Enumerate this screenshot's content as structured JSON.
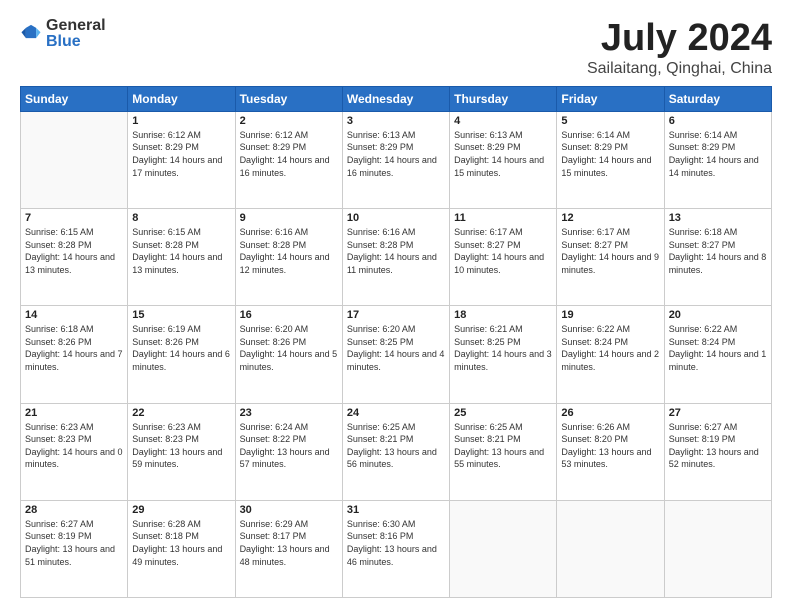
{
  "header": {
    "logo_general": "General",
    "logo_blue": "Blue",
    "month_title": "July 2024",
    "location": "Sailaitang, Qinghai, China"
  },
  "weekdays": [
    "Sunday",
    "Monday",
    "Tuesday",
    "Wednesday",
    "Thursday",
    "Friday",
    "Saturday"
  ],
  "weeks": [
    [
      {
        "day": "",
        "sunrise": "",
        "sunset": "",
        "daylight": ""
      },
      {
        "day": "1",
        "sunrise": "Sunrise: 6:12 AM",
        "sunset": "Sunset: 8:29 PM",
        "daylight": "Daylight: 14 hours and 17 minutes."
      },
      {
        "day": "2",
        "sunrise": "Sunrise: 6:12 AM",
        "sunset": "Sunset: 8:29 PM",
        "daylight": "Daylight: 14 hours and 16 minutes."
      },
      {
        "day": "3",
        "sunrise": "Sunrise: 6:13 AM",
        "sunset": "Sunset: 8:29 PM",
        "daylight": "Daylight: 14 hours and 16 minutes."
      },
      {
        "day": "4",
        "sunrise": "Sunrise: 6:13 AM",
        "sunset": "Sunset: 8:29 PM",
        "daylight": "Daylight: 14 hours and 15 minutes."
      },
      {
        "day": "5",
        "sunrise": "Sunrise: 6:14 AM",
        "sunset": "Sunset: 8:29 PM",
        "daylight": "Daylight: 14 hours and 15 minutes."
      },
      {
        "day": "6",
        "sunrise": "Sunrise: 6:14 AM",
        "sunset": "Sunset: 8:29 PM",
        "daylight": "Daylight: 14 hours and 14 minutes."
      }
    ],
    [
      {
        "day": "7",
        "sunrise": "Sunrise: 6:15 AM",
        "sunset": "Sunset: 8:28 PM",
        "daylight": "Daylight: 14 hours and 13 minutes."
      },
      {
        "day": "8",
        "sunrise": "Sunrise: 6:15 AM",
        "sunset": "Sunset: 8:28 PM",
        "daylight": "Daylight: 14 hours and 13 minutes."
      },
      {
        "day": "9",
        "sunrise": "Sunrise: 6:16 AM",
        "sunset": "Sunset: 8:28 PM",
        "daylight": "Daylight: 14 hours and 12 minutes."
      },
      {
        "day": "10",
        "sunrise": "Sunrise: 6:16 AM",
        "sunset": "Sunset: 8:28 PM",
        "daylight": "Daylight: 14 hours and 11 minutes."
      },
      {
        "day": "11",
        "sunrise": "Sunrise: 6:17 AM",
        "sunset": "Sunset: 8:27 PM",
        "daylight": "Daylight: 14 hours and 10 minutes."
      },
      {
        "day": "12",
        "sunrise": "Sunrise: 6:17 AM",
        "sunset": "Sunset: 8:27 PM",
        "daylight": "Daylight: 14 hours and 9 minutes."
      },
      {
        "day": "13",
        "sunrise": "Sunrise: 6:18 AM",
        "sunset": "Sunset: 8:27 PM",
        "daylight": "Daylight: 14 hours and 8 minutes."
      }
    ],
    [
      {
        "day": "14",
        "sunrise": "Sunrise: 6:18 AM",
        "sunset": "Sunset: 8:26 PM",
        "daylight": "Daylight: 14 hours and 7 minutes."
      },
      {
        "day": "15",
        "sunrise": "Sunrise: 6:19 AM",
        "sunset": "Sunset: 8:26 PM",
        "daylight": "Daylight: 14 hours and 6 minutes."
      },
      {
        "day": "16",
        "sunrise": "Sunrise: 6:20 AM",
        "sunset": "Sunset: 8:26 PM",
        "daylight": "Daylight: 14 hours and 5 minutes."
      },
      {
        "day": "17",
        "sunrise": "Sunrise: 6:20 AM",
        "sunset": "Sunset: 8:25 PM",
        "daylight": "Daylight: 14 hours and 4 minutes."
      },
      {
        "day": "18",
        "sunrise": "Sunrise: 6:21 AM",
        "sunset": "Sunset: 8:25 PM",
        "daylight": "Daylight: 14 hours and 3 minutes."
      },
      {
        "day": "19",
        "sunrise": "Sunrise: 6:22 AM",
        "sunset": "Sunset: 8:24 PM",
        "daylight": "Daylight: 14 hours and 2 minutes."
      },
      {
        "day": "20",
        "sunrise": "Sunrise: 6:22 AM",
        "sunset": "Sunset: 8:24 PM",
        "daylight": "Daylight: 14 hours and 1 minute."
      }
    ],
    [
      {
        "day": "21",
        "sunrise": "Sunrise: 6:23 AM",
        "sunset": "Sunset: 8:23 PM",
        "daylight": "Daylight: 14 hours and 0 minutes."
      },
      {
        "day": "22",
        "sunrise": "Sunrise: 6:23 AM",
        "sunset": "Sunset: 8:23 PM",
        "daylight": "Daylight: 13 hours and 59 minutes."
      },
      {
        "day": "23",
        "sunrise": "Sunrise: 6:24 AM",
        "sunset": "Sunset: 8:22 PM",
        "daylight": "Daylight: 13 hours and 57 minutes."
      },
      {
        "day": "24",
        "sunrise": "Sunrise: 6:25 AM",
        "sunset": "Sunset: 8:21 PM",
        "daylight": "Daylight: 13 hours and 56 minutes."
      },
      {
        "day": "25",
        "sunrise": "Sunrise: 6:25 AM",
        "sunset": "Sunset: 8:21 PM",
        "daylight": "Daylight: 13 hours and 55 minutes."
      },
      {
        "day": "26",
        "sunrise": "Sunrise: 6:26 AM",
        "sunset": "Sunset: 8:20 PM",
        "daylight": "Daylight: 13 hours and 53 minutes."
      },
      {
        "day": "27",
        "sunrise": "Sunrise: 6:27 AM",
        "sunset": "Sunset: 8:19 PM",
        "daylight": "Daylight: 13 hours and 52 minutes."
      }
    ],
    [
      {
        "day": "28",
        "sunrise": "Sunrise: 6:27 AM",
        "sunset": "Sunset: 8:19 PM",
        "daylight": "Daylight: 13 hours and 51 minutes."
      },
      {
        "day": "29",
        "sunrise": "Sunrise: 6:28 AM",
        "sunset": "Sunset: 8:18 PM",
        "daylight": "Daylight: 13 hours and 49 minutes."
      },
      {
        "day": "30",
        "sunrise": "Sunrise: 6:29 AM",
        "sunset": "Sunset: 8:17 PM",
        "daylight": "Daylight: 13 hours and 48 minutes."
      },
      {
        "day": "31",
        "sunrise": "Sunrise: 6:30 AM",
        "sunset": "Sunset: 8:16 PM",
        "daylight": "Daylight: 13 hours and 46 minutes."
      },
      {
        "day": "",
        "sunrise": "",
        "sunset": "",
        "daylight": ""
      },
      {
        "day": "",
        "sunrise": "",
        "sunset": "",
        "daylight": ""
      },
      {
        "day": "",
        "sunrise": "",
        "sunset": "",
        "daylight": ""
      }
    ]
  ]
}
